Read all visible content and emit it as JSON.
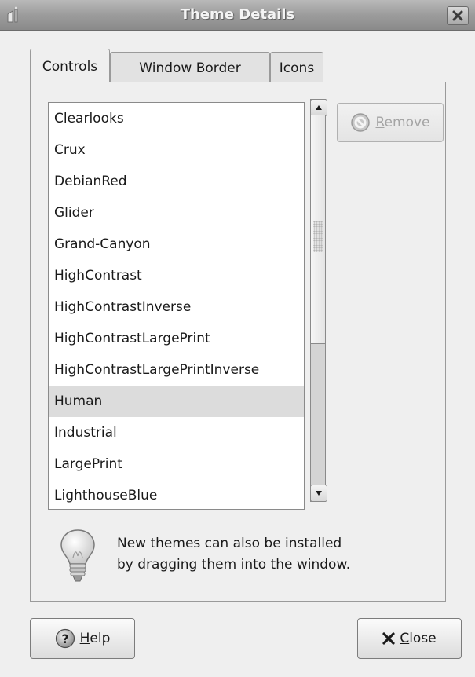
{
  "window": {
    "title": "Theme Details"
  },
  "tabs": [
    {
      "label": "Controls",
      "active": true
    },
    {
      "label": "Window Border",
      "active": false
    },
    {
      "label": "Icons",
      "active": false
    }
  ],
  "theme_list": {
    "items": [
      "Clearlooks",
      "Crux",
      "DebianRed",
      "Glider",
      "Grand-Canyon",
      "HighContrast",
      "HighContrastInverse",
      "HighContrastLargePrint",
      "HighContrastLargePrintInverse",
      "Human",
      "Industrial",
      "LargePrint",
      "LighthouseBlue"
    ],
    "selected": "Human"
  },
  "buttons": {
    "remove": {
      "mnemonic": "R",
      "rest": "emove",
      "enabled": false
    },
    "help": {
      "mnemonic": "H",
      "rest": "elp"
    },
    "close": {
      "mnemonic": "C",
      "rest": "lose"
    }
  },
  "hint": {
    "line1": "New themes can also be installed",
    "line2": "by dragging them into the window."
  },
  "icons": {
    "app": "app-icon",
    "window_close": "close-icon",
    "remove": "no-entry-icon",
    "help": "help-icon",
    "close": "x-icon",
    "hint": "lightbulb-icon",
    "scroll_up": "arrow-up-icon",
    "scroll_down": "arrow-down-icon"
  },
  "colors": {
    "selection": "#dcdcdc",
    "titlebar": "#9c9c9c"
  }
}
